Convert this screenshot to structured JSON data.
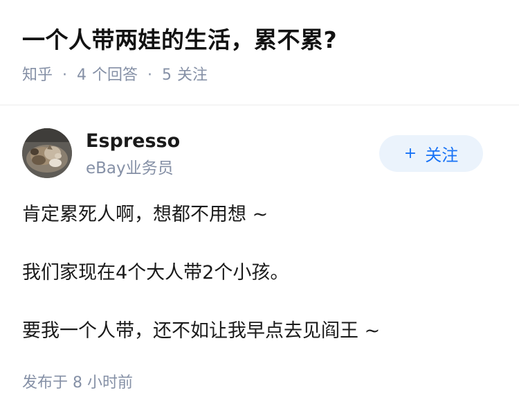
{
  "question": {
    "title": "一个人带两娃的生活，累不累?",
    "source": "知乎",
    "separator": "·",
    "answer_count": "4",
    "answer_label": "个回答",
    "follow_count": "5",
    "follow_label": "关注"
  },
  "author": {
    "name": "Espresso",
    "bio": "eBay业务员",
    "follow_button": "关注",
    "follow_icon": "+"
  },
  "answer": {
    "paragraphs": [
      "肯定累死人啊，想都不用想 ~",
      "我们家现在4个大人带2个小孩。",
      "要我一个人带，还不如让我早点去见阎王 ~"
    ],
    "published": "发布于  8 小时前"
  },
  "colors": {
    "accent": "#1772f6",
    "accent_bg": "#ebf3fc",
    "muted": "#8590a6",
    "text": "#1a1a1a"
  }
}
